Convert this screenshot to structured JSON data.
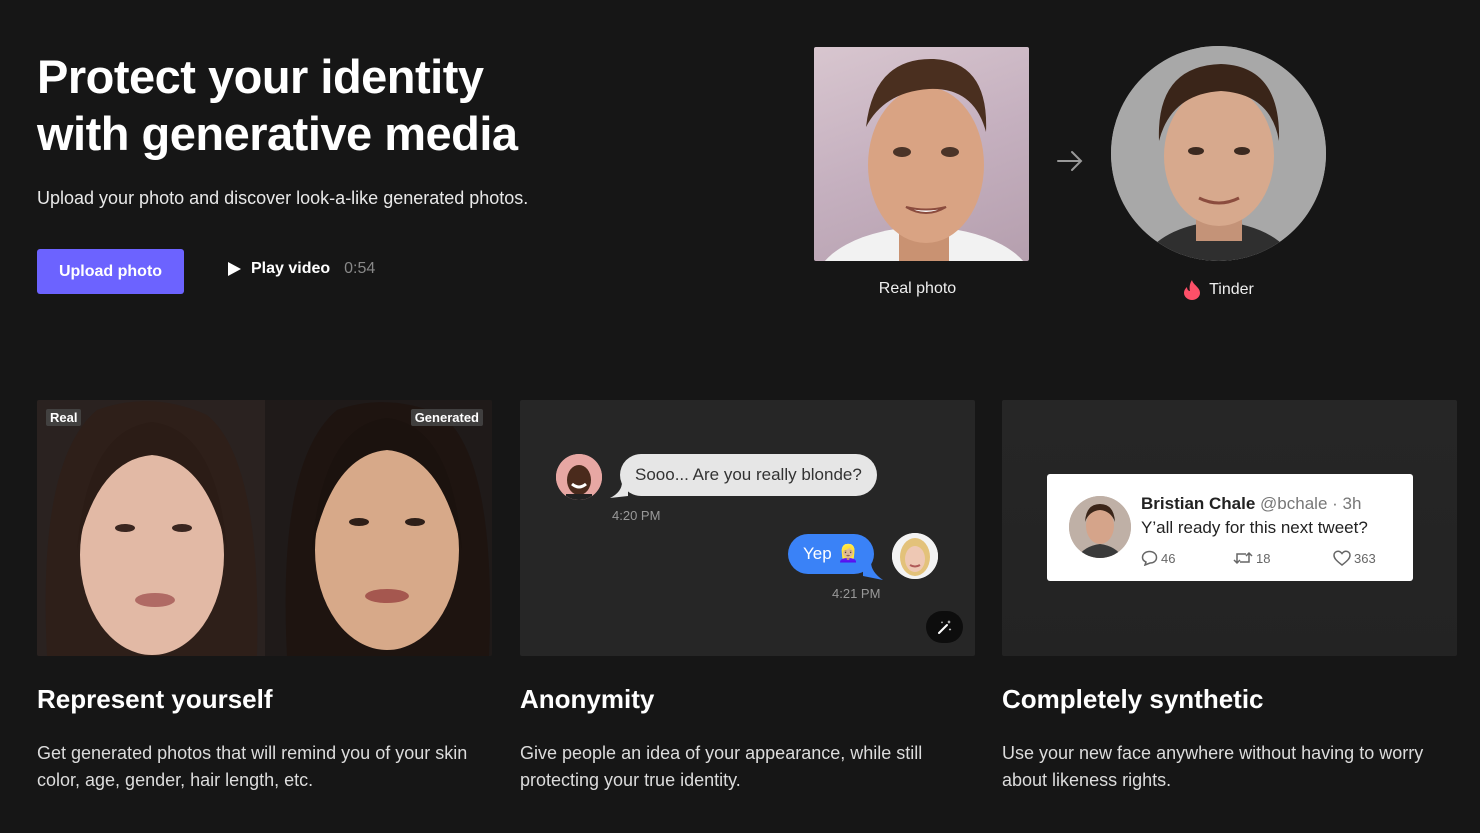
{
  "hero": {
    "title_line1": "Protect your identity",
    "title_line2": "with generative media",
    "subtitle": "Upload your photo and discover look-a-like generated photos.",
    "upload_label": "Upload photo",
    "play_label": "Play video",
    "play_duration": "0:54"
  },
  "comparison": {
    "real_caption": "Real photo",
    "generated_caption": "Tinder"
  },
  "features": [
    {
      "title": "Represent yourself",
      "description": "Get generated photos that will remind you of your skin color, age, gender, hair length, etc.",
      "tag_left": "Real",
      "tag_right": "Generated"
    },
    {
      "title": "Anonymity",
      "description": "Give people an idea of your appearance, while still protecting your true identity.",
      "chat": {
        "incoming_message": "Sooo... Are you really blonde?",
        "incoming_time": "4:20 PM",
        "outgoing_message": "Yep",
        "outgoing_emoji": "👱🏼‍♀️",
        "outgoing_time": "4:21 PM"
      }
    },
    {
      "title": "Completely synthetic",
      "description": "Use your new face anywhere without having to worry about likeness rights.",
      "tweet": {
        "name": "Bristian Chale",
        "handle": "@bchale · 3h",
        "text": "Y’all ready for this next tweet?",
        "replies": "46",
        "retweets": "18",
        "likes": "363"
      }
    }
  ],
  "colors": {
    "background": "#161616",
    "accent": "#6c63ff",
    "chat_blue": "#3a82f7",
    "tinder": "#fd5068"
  }
}
